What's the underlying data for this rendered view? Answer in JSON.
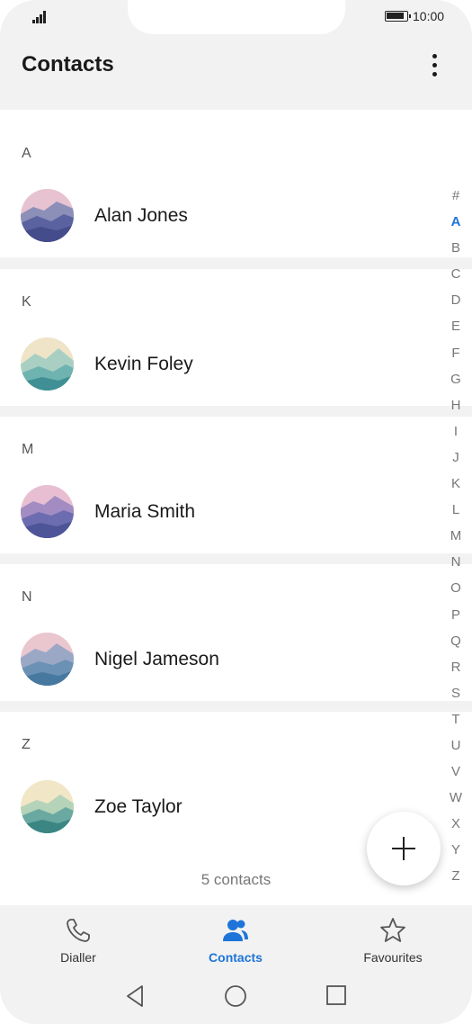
{
  "status": {
    "time": "10:00"
  },
  "header": {
    "title": "Contacts"
  },
  "contacts": [
    {
      "letter": "A",
      "name": "Alan Jones"
    },
    {
      "letter": "K",
      "name": "Kevin Foley"
    },
    {
      "letter": "M",
      "name": "Maria Smith"
    },
    {
      "letter": "N",
      "name": "Nigel Jameson"
    },
    {
      "letter": "Z",
      "name": "Zoe Taylor"
    }
  ],
  "index_letters": [
    "#",
    "A",
    "B",
    "C",
    "D",
    "E",
    "F",
    "G",
    "H",
    "I",
    "J",
    "K",
    "L",
    "M",
    "N",
    "O",
    "P",
    "Q",
    "R",
    "S",
    "T",
    "U",
    "V",
    "W",
    "X",
    "Y",
    "Z"
  ],
  "index_active": "A",
  "footer": {
    "count_text": "5 contacts"
  },
  "tabs": [
    {
      "label": "Dialler",
      "icon": "phone-icon"
    },
    {
      "label": "Contacts",
      "icon": "contacts-icon",
      "active": true
    },
    {
      "label": "Favourites",
      "icon": "star-icon"
    }
  ],
  "accent_color": "#1e74d8"
}
